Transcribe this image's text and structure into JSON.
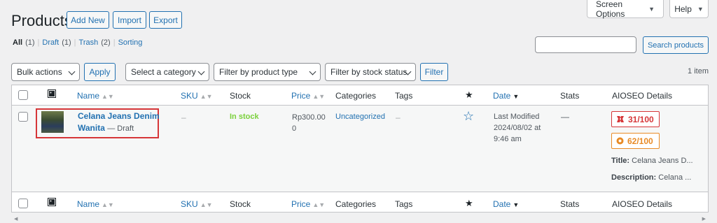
{
  "screen_meta": {
    "screen_options": "Screen Options",
    "help": "Help"
  },
  "page": {
    "title": "Products",
    "buttons": {
      "add_new": "Add New",
      "import": "Import",
      "export": "Export"
    }
  },
  "views": [
    {
      "label": "All",
      "count": "(1)"
    },
    {
      "label": "Draft",
      "count": "(1)"
    },
    {
      "label": "Trash",
      "count": "(2)"
    },
    {
      "label": "Sorting",
      "count": ""
    }
  ],
  "search": {
    "placeholder": "",
    "button": "Search products"
  },
  "filters": {
    "bulk_actions": "Bulk actions",
    "apply": "Apply",
    "category": "Select a category",
    "product_type": "Filter by product type",
    "stock_status": "Filter by stock status",
    "filter": "Filter",
    "items_count": "1 item"
  },
  "columns": {
    "image": "image-icon",
    "name": "Name",
    "sku": "SKU",
    "stock": "Stock",
    "price": "Price",
    "categories": "Categories",
    "tags": "Tags",
    "featured": "star-icon",
    "date": "Date",
    "stats": "Stats",
    "aioseo": "AIOSEO Details"
  },
  "rows": [
    {
      "name_line1": "Celana Jeans Denim",
      "name_line2": "Wanita",
      "status": "— Draft",
      "sku": "–",
      "stock": "In stock",
      "price_line1": "Rp300.00",
      "price_line2": "0",
      "category": "Uncategorized",
      "tags": "–",
      "date_line1": "Last Modified",
      "date_line2": "2024/08/02 at",
      "date_line3": "9:46 am",
      "stats": "—",
      "seo_score": "31/100",
      "truseo_score": "62/100",
      "title_label": "Title:",
      "title_value": "Celana Jeans D...",
      "desc_label": "Description:",
      "desc_value": "Celana ..."
    }
  ],
  "colors": {
    "accent": "#2271b1",
    "in_stock": "#7ad03a",
    "score_red": "#d63638",
    "score_orange": "#e88a25"
  }
}
